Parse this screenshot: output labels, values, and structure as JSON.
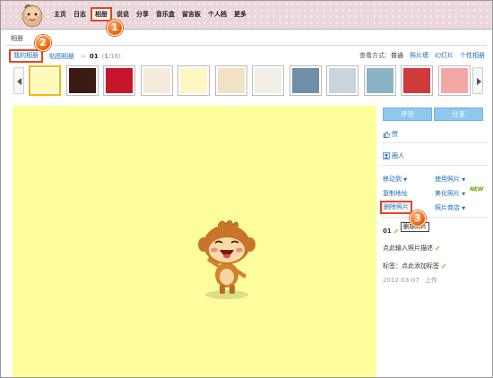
{
  "nav": {
    "items": [
      "主页",
      "日志",
      "相册",
      "说说",
      "分享",
      "音乐盒",
      "留言板",
      "个人档",
      "更多"
    ],
    "active_index": 2
  },
  "markers": [
    "1",
    "2",
    "3"
  ],
  "section_title": "相册",
  "breadcrumb": {
    "my_album": "我的相册",
    "sticker_album": "贴图相册",
    "separator": ">",
    "album_number": "01",
    "count_open": "(",
    "count_current": "1",
    "count_rest": "/16)"
  },
  "view_modes": {
    "label": "查看方式：",
    "current": "普通",
    "options": [
      "照片墙",
      "幻灯片",
      "个性相册"
    ]
  },
  "thumbnails": [
    {
      "name": "monkey-thumb",
      "bg": "#fff9b8",
      "selected": true
    },
    {
      "name": "dark-thumb",
      "bg": "#3b1a12",
      "selected": false
    },
    {
      "name": "heart-thumb",
      "bg": "#c8152b",
      "selected": false
    },
    {
      "name": "cream-thumb",
      "bg": "#f5ecd9",
      "selected": false
    },
    {
      "name": "cartoon-thumb",
      "bg": "#fff7c2",
      "selected": false
    },
    {
      "name": "beige-thumb",
      "bg": "#f1e2c4",
      "selected": false
    },
    {
      "name": "text-thumb",
      "bg": "#f3efe6",
      "selected": false
    },
    {
      "name": "people-thumb",
      "bg": "#6f8fa8",
      "selected": false
    },
    {
      "name": "bird-thumb",
      "bg": "#c9d4dc",
      "selected": false
    },
    {
      "name": "couple-thumb",
      "bg": "#8bb3c6",
      "selected": false
    },
    {
      "name": "red-pattern-thumb",
      "bg": "#cf3a3a",
      "selected": false
    },
    {
      "name": "pink-pattern-thumb",
      "bg": "#f4a7a7",
      "selected": false
    }
  ],
  "side": {
    "comment_button": "评论",
    "share_button": "分享",
    "like_label": "赞",
    "circle_label": "圈人",
    "actions": {
      "move_to": "移动到",
      "use_photo": "使用照片",
      "copy_address": "复制地址",
      "beautify_photo": "美化照片",
      "delete_photo": "删除照片",
      "photo_shop": "照片商店"
    },
    "new_badge": "NEW",
    "tooltip": "删除照片",
    "photo_name": "01",
    "add_description": "点此输入照片描述",
    "tags": "标签：点此添加标签",
    "upload_date": "2012-03-07",
    "upload_label": "上传"
  },
  "colors": {
    "accent": "#e8441c",
    "link": "#1a6db5",
    "photo_bg": "#fdfd9b",
    "button": "#8ec8ef"
  }
}
